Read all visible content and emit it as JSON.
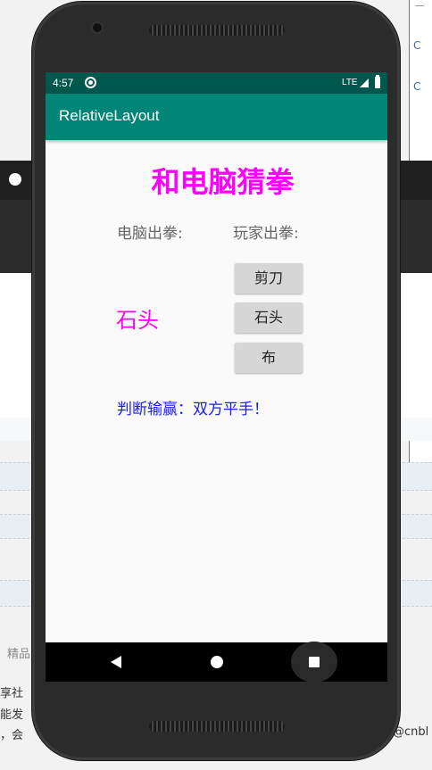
{
  "background": {
    "left_label": "精品",
    "line1": "享社",
    "line2": "能发",
    "line3_left": "，会",
    "line3_right": "@cnbl"
  },
  "status_bar": {
    "time": "4:57",
    "network": "LTE"
  },
  "app_bar": {
    "title": "RelativeLayout"
  },
  "game": {
    "title": "和电脑猜拳",
    "computer_label": "电脑出拳:",
    "player_label": "玩家出拳:",
    "computer_choice": "石头",
    "buttons": {
      "scissors": "剪刀",
      "rock": "石头",
      "paper": "布"
    },
    "result": "判断输赢：双方平手！"
  },
  "colors": {
    "status_bar": "#00574b",
    "app_bar": "#008577",
    "title": "#ff00ff",
    "result": "#1a1aff"
  },
  "icons": {
    "status_sync": "sync-icon",
    "status_signal": "signal-icon",
    "status_battery": "battery-icon",
    "nav_back": "back-icon",
    "nav_home": "home-icon",
    "nav_recents": "recents-icon"
  }
}
